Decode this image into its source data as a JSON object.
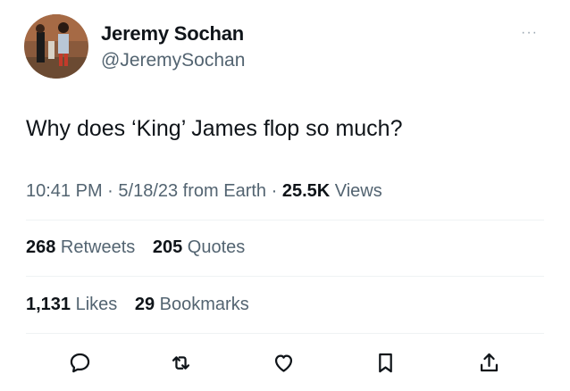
{
  "author": {
    "display_name": "Jeremy Sochan",
    "handle": "@JeremySochan"
  },
  "tweet": {
    "text": "Why does ‘King’ James flop so much?"
  },
  "meta": {
    "time": "10:41 PM",
    "separator1": " · ",
    "date": "5/18/23 from Earth",
    "separator2": " · ",
    "views_count": "25.5K",
    "views_label": " Views"
  },
  "stats": {
    "retweets_count": "268",
    "retweets_label": " Retweets",
    "quotes_count": "205",
    "quotes_label": " Quotes",
    "likes_count": "1,131",
    "likes_label": " Likes",
    "bookmarks_count": "29",
    "bookmarks_label": " Bookmarks"
  },
  "more_icon": "···",
  "icons": {
    "reply": "reply-icon",
    "retweet": "retweet-icon",
    "like": "heart-icon",
    "bookmark": "bookmark-icon",
    "share": "share-icon"
  },
  "colors": {
    "text_primary": "#0f1419",
    "text_secondary": "#536471",
    "divider": "#eff3f4"
  }
}
